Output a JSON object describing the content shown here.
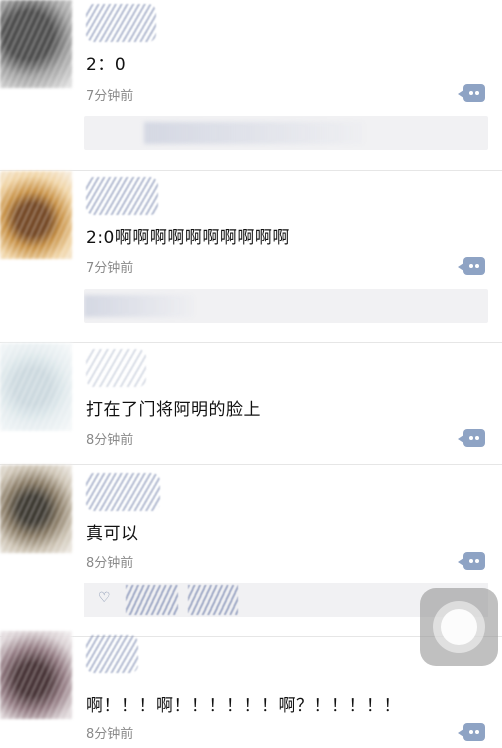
{
  "comments": [
    {
      "text": "2：0",
      "time": "7分钟前",
      "has_reply_box": true
    },
    {
      "text": "2:0啊啊啊啊啊啊啊啊啊啊",
      "time": "7分钟前",
      "has_reply_box": true
    },
    {
      "text": "打在了门将阿明的脸上",
      "time": "8分钟前",
      "has_reply_box": false
    },
    {
      "text": "真可以",
      "time": "8分钟前",
      "has_like_bar": true
    },
    {
      "text": "啊！！！啊！！！！！！啊？！！！！！",
      "time": "8分钟前",
      "has_reply_box": false
    }
  ],
  "icons": {
    "reply": "comment-bubble-icon",
    "like": "heart-icon",
    "assistive_touch": "assistive-touch-icon"
  },
  "colors": {
    "text": "#111111",
    "time": "#8a8a8a",
    "icon": "#8ea3c4",
    "reply_bg": "#f1f1f3"
  }
}
